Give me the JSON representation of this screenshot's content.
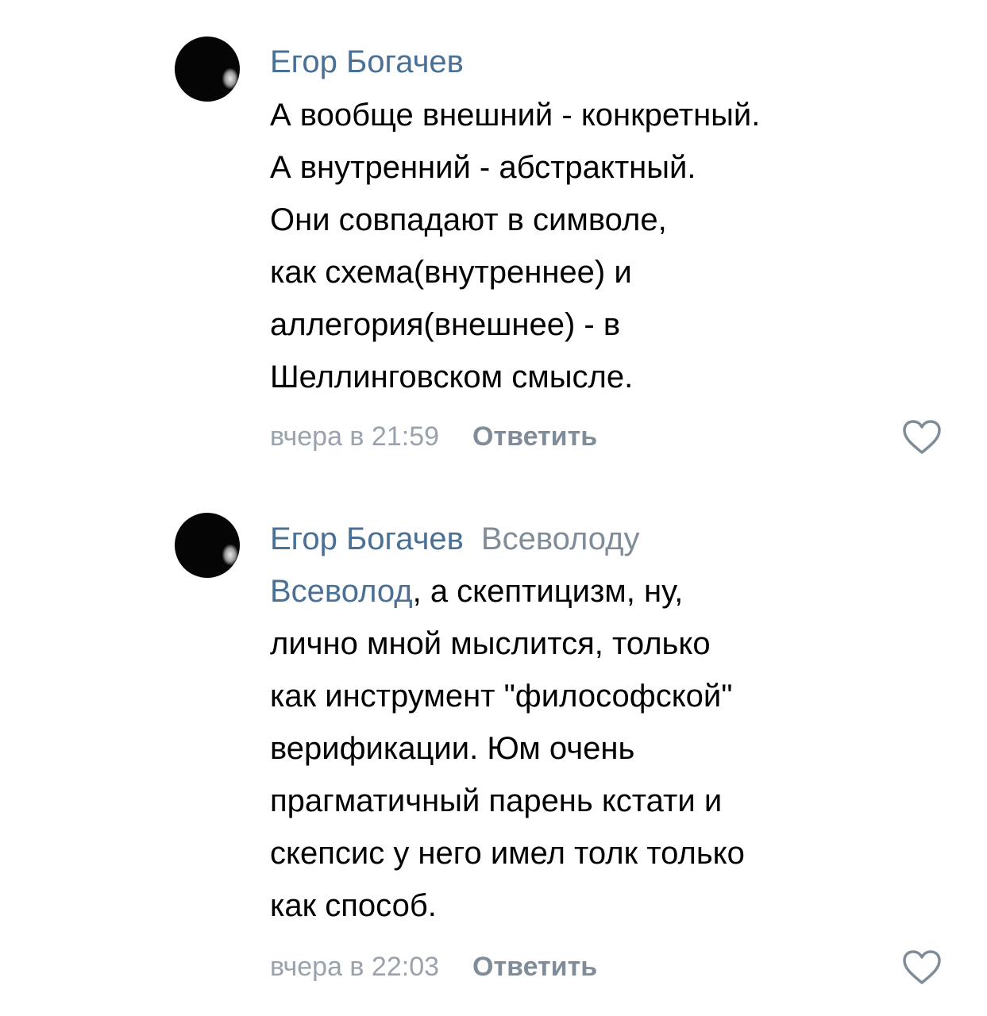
{
  "comments": [
    {
      "author": "Егор Богачев",
      "reply_to": "",
      "mention": "",
      "text": "А вообще внешний - конкретный.\nА внутренний - абстрактный.\nОни совпадают в символе,\nкак схема(внутреннее) и\nаллегория(внешнее) - в\nШеллинговском смысле.",
      "timestamp": "вчера в 21:59",
      "reply_label": "Ответить",
      "like_icon": "heart-outline-icon"
    },
    {
      "author": "Егор Богачев",
      "reply_to": "Всеволоду",
      "mention": "Всеволод",
      "text": ", а скептицизм, ну,\nлично мной мыслится, только\nкак инструмент \"философской\"\nверификации. Юм очень\nпрагматичный парень кстати и\nскепсис у него имел толк только\nкак способ.",
      "timestamp": "вчера в 22:03",
      "reply_label": "Ответить",
      "like_icon": "heart-outline-icon"
    }
  ],
  "colors": {
    "link": "#4a7096",
    "secondary": "#818c99",
    "timestamp": "#99a2ad",
    "text": "#000000",
    "background": "#ffffff"
  }
}
